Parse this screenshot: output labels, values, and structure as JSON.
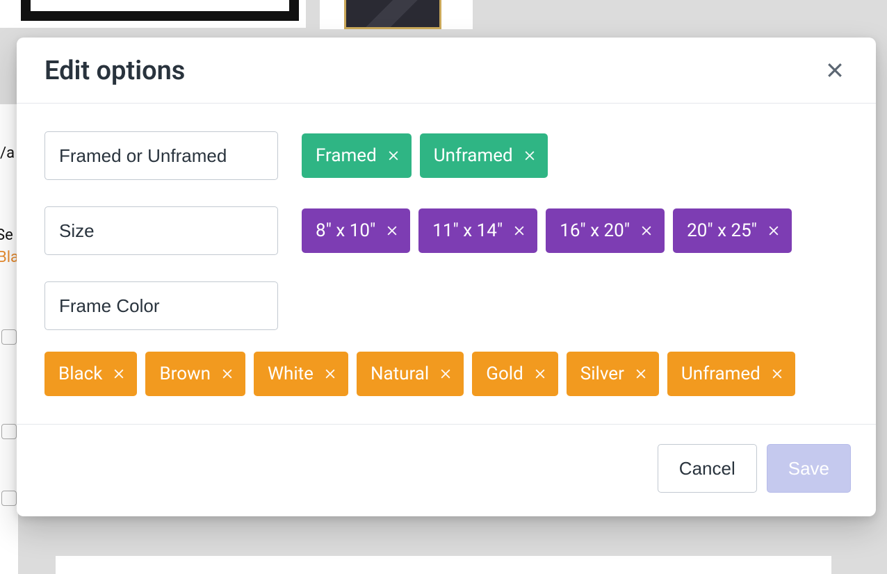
{
  "modal": {
    "title": "Edit options",
    "options": [
      {
        "name": "Framed or Unframed",
        "color": "green",
        "values": [
          "Framed",
          "Unframed"
        ]
      },
      {
        "name": "Size",
        "color": "purple",
        "values": [
          "8\" x 10\"",
          "11\" x 14\"",
          "16\" x 20\"",
          "20\" x 25\""
        ]
      },
      {
        "name": "Frame Color",
        "color": "orange",
        "values": [
          "Black",
          "Brown",
          "White",
          "Natural",
          "Gold",
          "Silver",
          "Unframed"
        ]
      }
    ],
    "buttons": {
      "cancel": "Cancel",
      "save": "Save"
    }
  },
  "background": {
    "left_fragments": [
      "/a",
      "Se",
      "Bla"
    ]
  }
}
